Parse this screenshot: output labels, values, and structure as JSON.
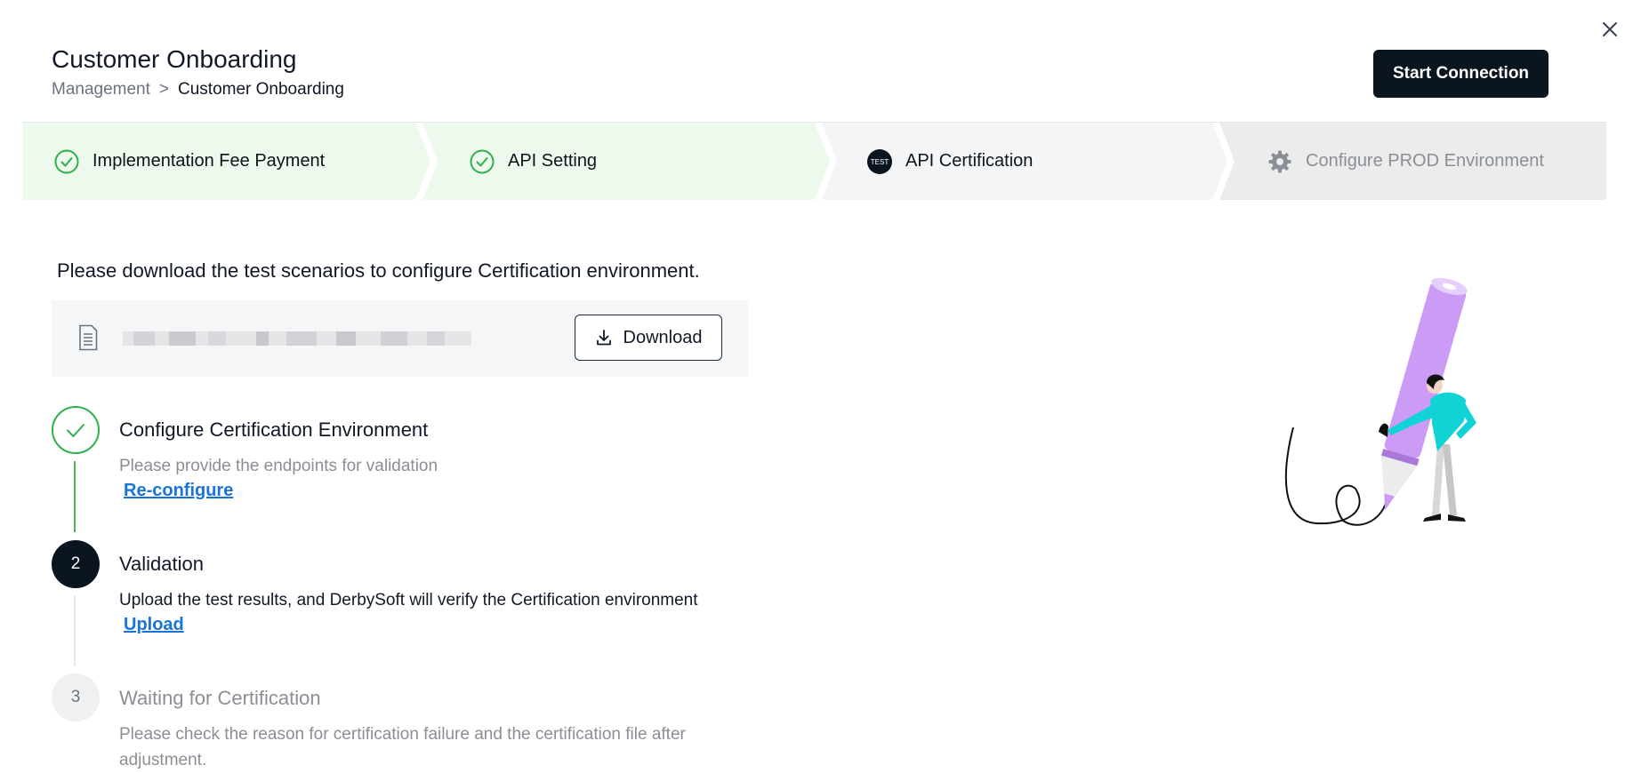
{
  "header": {
    "title": "Customer Onboarding",
    "breadcrumb": {
      "parent": "Management",
      "separator": ">",
      "current": "Customer Onboarding"
    },
    "primary_action": "Start Connection",
    "close_icon": "close-icon"
  },
  "stepper": {
    "steps": [
      {
        "label": "Implementation Fee Payment",
        "status": "completed",
        "icon": "check-circle-icon"
      },
      {
        "label": "API Setting",
        "status": "completed",
        "icon": "check-circle-icon"
      },
      {
        "label": "API Certification",
        "status": "current",
        "icon": "test-badge-icon",
        "badge_text": "TEST"
      },
      {
        "label": "Configure PROD Environment",
        "status": "pending",
        "icon": "gear-icon"
      }
    ],
    "colors": {
      "completed_bg": "#eef9ee",
      "current_bg": "#f4f5f6",
      "pending_bg": "#ececed",
      "check": "#2db14a"
    }
  },
  "main": {
    "instruction": "Please download the test scenarios to configure Certification environment.",
    "file": {
      "icon": "document-icon",
      "download_label": "Download"
    },
    "substeps": [
      {
        "marker": "check",
        "title": "Configure Certification Environment",
        "description": "Please provide the endpoints for validation",
        "link": "Re-configure",
        "status": "completed"
      },
      {
        "marker": "2",
        "title": "Validation",
        "description": "Upload the test results, and DerbySoft will verify the Certification environment",
        "link": "Upload",
        "status": "current"
      },
      {
        "marker": "3",
        "title": "Waiting for Certification",
        "description": "Please check the reason for certification failure and the certification file after adjustment.",
        "status": "pending"
      }
    ],
    "link_color": "#1a73d9"
  },
  "illustration": {
    "name": "pencil-person-illustration",
    "pencil_color": "#cc9bf5",
    "shirt_color": "#10d3d6"
  }
}
